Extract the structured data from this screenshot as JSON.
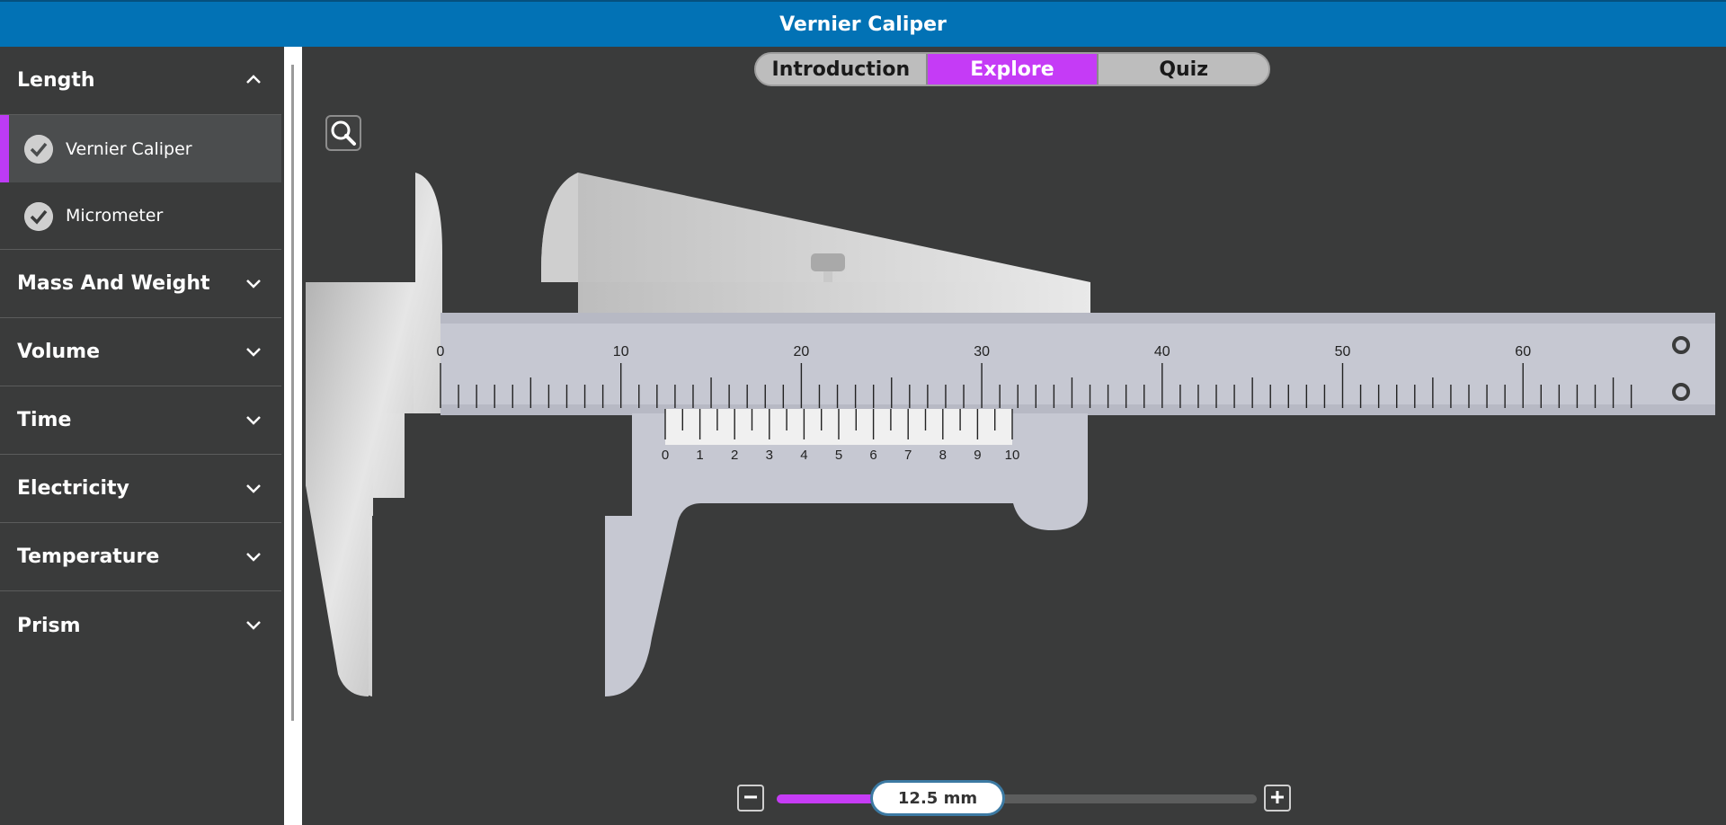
{
  "header": {
    "title": "Vernier Caliper"
  },
  "sidebar": {
    "categories": [
      {
        "label": "Length",
        "expanded": true,
        "items": [
          {
            "label": "Vernier Caliper",
            "active": true
          },
          {
            "label": "Micrometer",
            "active": false
          }
        ]
      },
      {
        "label": "Mass And Weight",
        "expanded": false
      },
      {
        "label": "Volume",
        "expanded": false
      },
      {
        "label": "Time",
        "expanded": false
      },
      {
        "label": "Electricity",
        "expanded": false
      },
      {
        "label": "Temperature",
        "expanded": false
      },
      {
        "label": "Prism",
        "expanded": false
      }
    ]
  },
  "tabs": [
    {
      "label": "Introduction",
      "active": false
    },
    {
      "label": "Explore",
      "active": true
    },
    {
      "label": "Quiz",
      "active": false
    }
  ],
  "caliper": {
    "main_scale_labels": [
      "0",
      "10",
      "20",
      "30",
      "40",
      "50",
      "60"
    ],
    "vernier_scale_labels": [
      "0",
      "1",
      "2",
      "3",
      "4",
      "5",
      "6",
      "7",
      "8",
      "9",
      "10"
    ],
    "reading_mm": 12.5
  },
  "slider": {
    "value_label": "12.5 mm",
    "minus_label": "−",
    "plus_label": "+",
    "fraction": 0.19
  },
  "colors": {
    "header_bg": "#0272b5",
    "accent": "#c53bf6",
    "panel_bg": "#3a3b3b",
    "body_metal": "#c7c9d2"
  },
  "icons": {
    "zoom": "search-icon",
    "expanded": "chevron-up-icon",
    "collapsed": "chevron-down-icon",
    "done": "check-circle-icon"
  }
}
